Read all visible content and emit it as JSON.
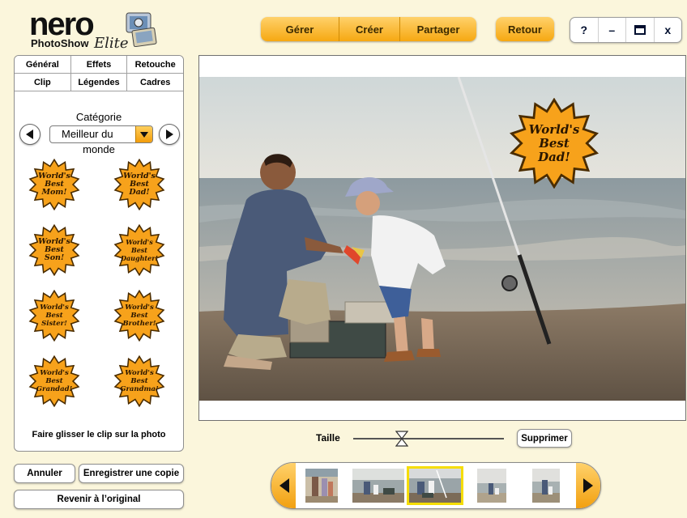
{
  "logo": {
    "brand": "nero",
    "product": "PhotoShow",
    "edition": "Elite"
  },
  "nav": {
    "manage": "Gérer",
    "create": "Créer",
    "share": "Partager",
    "back": "Retour"
  },
  "window": {
    "help": "?",
    "minimize": "–",
    "maximize": "☐",
    "close": "x"
  },
  "tabs": {
    "row1": [
      "Général",
      "Effets",
      "Retouche"
    ],
    "row2": [
      "Clip",
      "Légendes",
      "Cadres"
    ]
  },
  "category": {
    "label": "Catégorie",
    "selected_short": "Meilleur du",
    "selected_wrap": "monde"
  },
  "clips": [
    "World's\nBest\nMom!",
    "World's\nBest\nDad!",
    "World's\nBest\nSon!",
    "World's\nBest\nDaughter!",
    "World's\nBest\nSister!",
    "World's\nBest\nBrother!",
    "World's\nBest\nGrandad!",
    "World's\nBest\nGrandma!"
  ],
  "drag_hint": "Faire glisser le clip sur la photo",
  "buttons": {
    "cancel": "Annuler",
    "save_copy": "Enregistrer une copie",
    "revert": "Revenir à l’original",
    "delete": "Supprimer"
  },
  "placed_clip_text": "World's\nBest\nDad!",
  "size": {
    "label": "Taille",
    "level": 0.32
  },
  "colors": {
    "accent_orange": "#f6a812",
    "badge_orange": "#f7a21b",
    "selection_yellow": "#f5dd06",
    "background": "#fbf6dc"
  },
  "icons": [
    "left-arrow-icon",
    "right-arrow-icon",
    "dropdown-arrow-icon",
    "hourglass-slider-icon"
  ],
  "filmstrip": {
    "selected_index": 2,
    "count": 5
  }
}
